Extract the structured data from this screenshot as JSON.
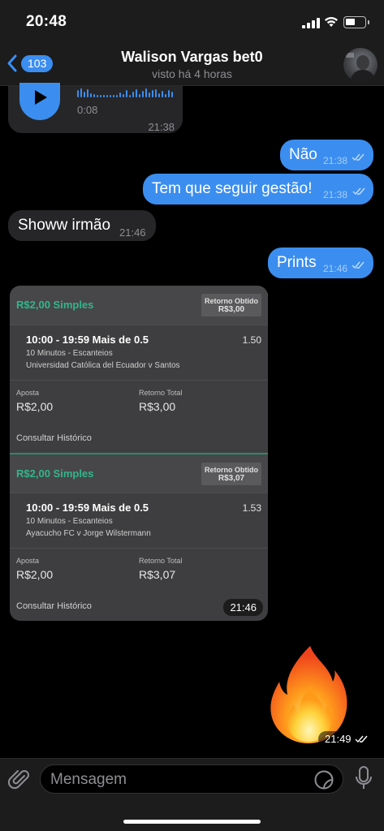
{
  "status": {
    "time": "20:48"
  },
  "header": {
    "back_count": "103",
    "title": "Walison Vargas bet0",
    "subtitle": "visto há 4 horas"
  },
  "messages": {
    "voice": {
      "duration": "0:08",
      "time": "21:38"
    },
    "nao": {
      "text": "Não",
      "time": "21:38"
    },
    "gestao": {
      "text": "Tem que seguir gestão!",
      "time": "21:38"
    },
    "showw": {
      "text": "Showw irmão",
      "time": "21:46"
    },
    "prints": {
      "text": "Prints",
      "time": "21:46"
    },
    "card_time": "21:46",
    "fire_time": "21:49"
  },
  "bets": [
    {
      "amount": "R$2,00 Simples",
      "return_label": "Retorno Obtido",
      "return_value": "R$3,00",
      "line": "10:00 - 19:59 Mais de 0.5",
      "odd": "1.50",
      "market": "10 Minutos - Escanteios",
      "match": "Universidad Católica del Ecuador v Santos",
      "stake_label": "Aposta",
      "stake": "R$2,00",
      "total_label": "Retorno Total",
      "total": "R$3,00",
      "history": "Consultar Histórico"
    },
    {
      "amount": "R$2,00 Simples",
      "return_label": "Retorno Obtido",
      "return_value": "R$3,07",
      "line": "10:00 - 19:59 Mais de 0.5",
      "odd": "1.53",
      "market": "10 Minutos - Escanteios",
      "match": "Ayacucho FC v Jorge Wilstermann",
      "stake_label": "Aposta",
      "stake": "R$2,00",
      "total_label": "Retorno Total",
      "total": "R$3,07",
      "history": "Consultar Histórico"
    }
  ],
  "input": {
    "placeholder": "Mensagem"
  },
  "colors": {
    "accent": "#3b8ef0",
    "incoming": "#262628",
    "bet_green": "#32b68b"
  }
}
